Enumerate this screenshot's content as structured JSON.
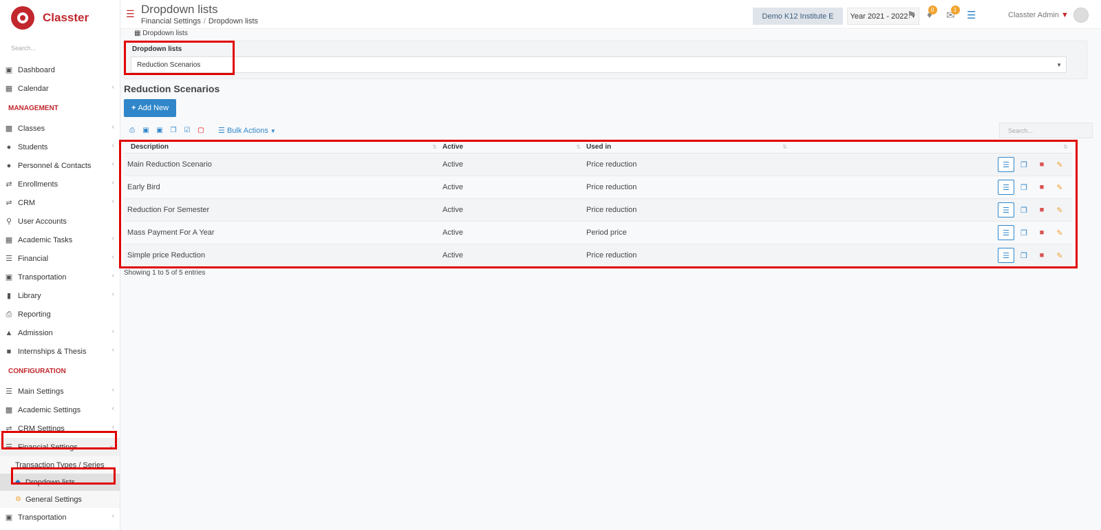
{
  "brand": {
    "name": "Classter"
  },
  "sidebar": {
    "search_placeholder": "Search...",
    "top_items": [
      {
        "label": "Dashboard",
        "icon": "laptop-icon"
      },
      {
        "label": "Calendar",
        "icon": "calendar-icon"
      }
    ],
    "management_header": "MANAGEMENT",
    "management_items": [
      {
        "label": "Classes",
        "icon": "classes-icon"
      },
      {
        "label": "Students",
        "icon": "students-icon"
      },
      {
        "label": "Personnel & Contacts",
        "icon": "personnel-icon"
      },
      {
        "label": "Enrollments",
        "icon": "exchange-icon"
      },
      {
        "label": "CRM",
        "icon": "shuffle-icon"
      },
      {
        "label": "User Accounts",
        "icon": "key-icon"
      },
      {
        "label": "Academic Tasks",
        "icon": "tasks-icon"
      },
      {
        "label": "Financial",
        "icon": "coins-icon"
      },
      {
        "label": "Transportation",
        "icon": "bus-icon"
      },
      {
        "label": "Library",
        "icon": "library-icon"
      },
      {
        "label": "Reporting",
        "icon": "printer-icon"
      },
      {
        "label": "Admission",
        "icon": "institution-icon"
      },
      {
        "label": "Internships & Thesis",
        "icon": "cube-icon"
      }
    ],
    "config_header": "CONFIGURATION",
    "config_items": [
      {
        "label": "Main Settings",
        "icon": "sliders-icon"
      },
      {
        "label": "Academic Settings",
        "icon": "classes-icon"
      },
      {
        "label": "CRM Settings",
        "icon": "shuffle-icon"
      }
    ],
    "financial_settings": {
      "label": "Financial Settings",
      "sub": [
        {
          "label": "Transaction Types / Series"
        },
        {
          "label": "Dropdown lists"
        },
        {
          "label": "General Settings"
        }
      ]
    },
    "bottom_item": {
      "label": "Transportation"
    }
  },
  "topbar": {
    "title": "Dropdown lists",
    "breadcrumb": [
      "Financial Settings",
      "Dropdown lists"
    ],
    "institution": "Demo K12 Institute E",
    "year": "Year 2021 - 2022",
    "notifications_count": "0",
    "messages_count": "1",
    "user": "Classter Admin"
  },
  "main": {
    "small_label": "Dropdown lists",
    "dropdown_label": "Dropdown lists",
    "dropdown_value": "Reduction Scenarios",
    "section_title": "Reduction Scenarios",
    "add_new": "Add New",
    "bulk_actions": "Bulk Actions",
    "search_placeholder": "Search...",
    "columns": [
      "Description",
      "Active",
      "Used in"
    ],
    "rows": [
      {
        "description": "Main Reduction Scenario",
        "active": "Active",
        "used_in": "Price reduction"
      },
      {
        "description": "Early Bird",
        "active": "Active",
        "used_in": "Price reduction"
      },
      {
        "description": "Reduction For Semester",
        "active": "Active",
        "used_in": "Price reduction"
      },
      {
        "description": "Mass Payment For A Year",
        "active": "Active",
        "used_in": "Period price"
      },
      {
        "description": "Simple price Reduction",
        "active": "Active",
        "used_in": "Price reduction"
      }
    ],
    "entries_info": "Showing 1 to 5 of 5 entries"
  },
  "colors": {
    "brand": "#c1272d",
    "primary": "#2f86c9",
    "highlight": "#e00000"
  }
}
